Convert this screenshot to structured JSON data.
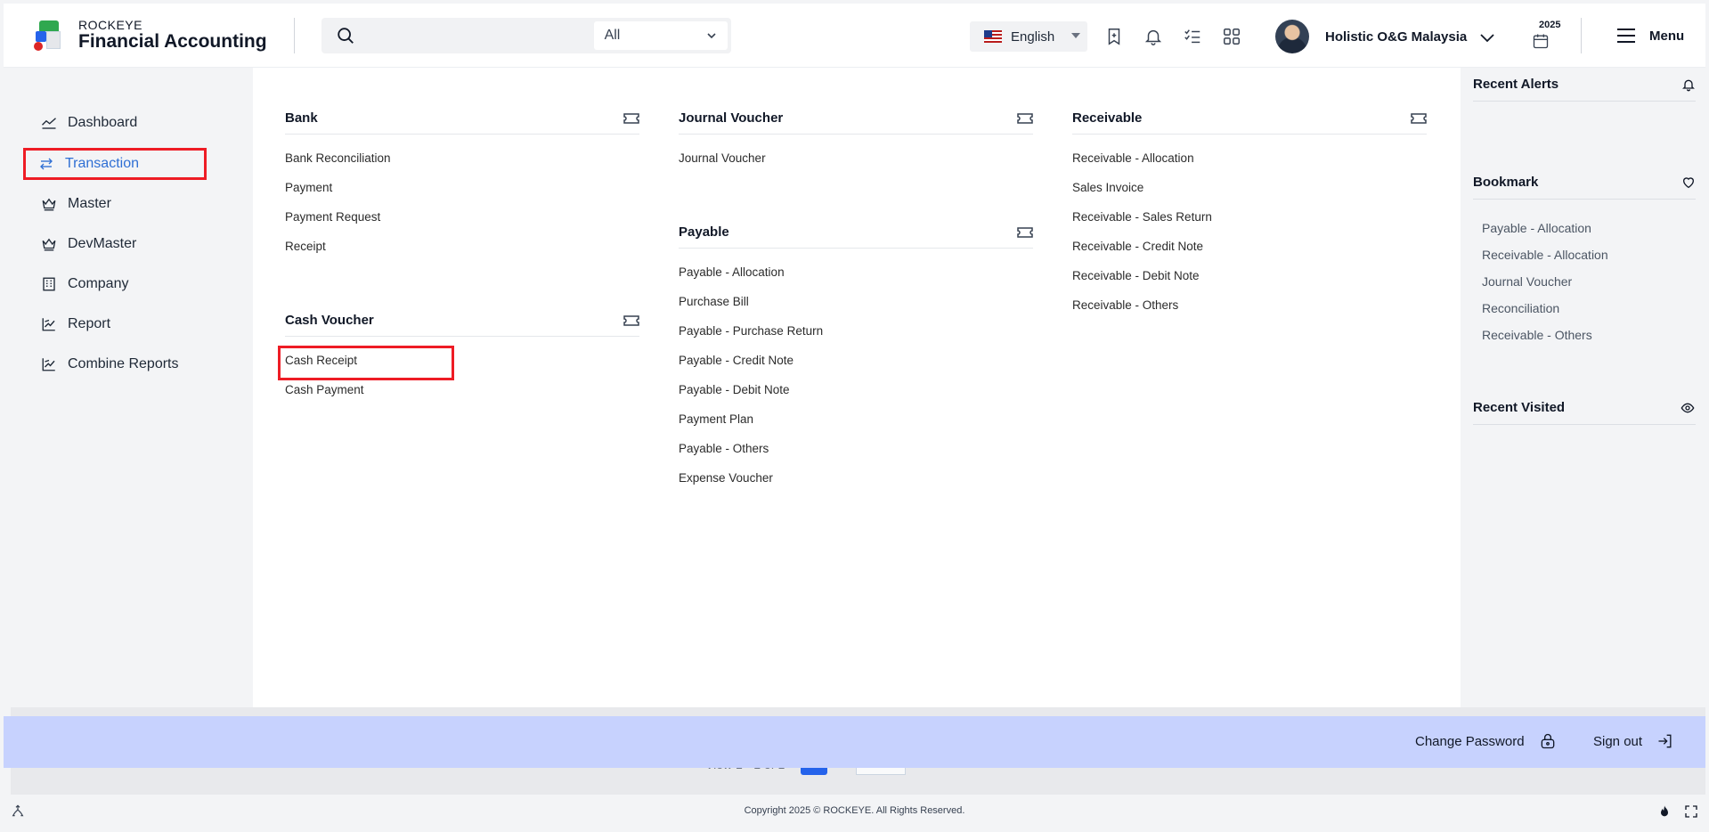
{
  "header": {
    "brand_small": "ROCKEYE",
    "brand_big": "Financial Accounting",
    "search_placeholder": "",
    "search_scope": "All",
    "language": "English",
    "company_name": "Holistic O&G Malaysia",
    "year": "2025",
    "menu_label": "Menu"
  },
  "sidebar": {
    "items": [
      {
        "label": "Dashboard",
        "icon": "chart-line-icon"
      },
      {
        "label": "Transaction",
        "icon": "swap-arrows-icon",
        "active": true
      },
      {
        "label": "Master",
        "icon": "crown-icon"
      },
      {
        "label": "DevMaster",
        "icon": "crown-icon"
      },
      {
        "label": "Company",
        "icon": "building-icon"
      },
      {
        "label": "Report",
        "icon": "report-chart-icon"
      },
      {
        "label": "Combine Reports",
        "icon": "report-chart-icon"
      }
    ]
  },
  "mega_menu": {
    "bank": {
      "title": "Bank",
      "links": [
        "Bank Reconciliation",
        "Payment",
        "Payment Request",
        "Receipt"
      ]
    },
    "cash_voucher": {
      "title": "Cash Voucher",
      "links": [
        "Cash Receipt",
        "Cash Payment"
      ]
    },
    "journal_voucher": {
      "title": "Journal Voucher",
      "links": [
        "Journal Voucher"
      ]
    },
    "payable": {
      "title": "Payable",
      "links": [
        "Payable - Allocation",
        "Purchase Bill",
        "Payable - Purchase Return",
        "Payable - Credit Note",
        "Payable - Debit Note",
        "Payment Plan",
        "Payable - Others",
        "Expense Voucher"
      ]
    },
    "receivable": {
      "title": "Receivable",
      "links": [
        "Receivable - Allocation",
        "Sales Invoice",
        "Receivable - Sales Return",
        "Receivable - Credit Note",
        "Receivable - Debit Note",
        "Receivable - Others"
      ]
    }
  },
  "right_panel": {
    "recent_alerts": "Recent Alerts",
    "bookmark": "Bookmark",
    "bookmark_items": [
      "Payable - Allocation",
      "Receivable - Allocation",
      "Journal Voucher",
      "Reconciliation",
      "Receivable - Others"
    ],
    "recent_visited": "Recent Visited"
  },
  "pager": {
    "text": "View 1 - 1 of 1",
    "page": "1",
    "size": "20"
  },
  "account_bar": {
    "change_password": "Change Password",
    "sign_out": "Sign out"
  },
  "footer": {
    "copyright": "Copyright 2025 © ROCKEYE. All Rights Reserved."
  },
  "colors": {
    "accent": "#2f6fd4",
    "highlight": "#ee1c25",
    "account_bar": "#c7d2fe"
  }
}
